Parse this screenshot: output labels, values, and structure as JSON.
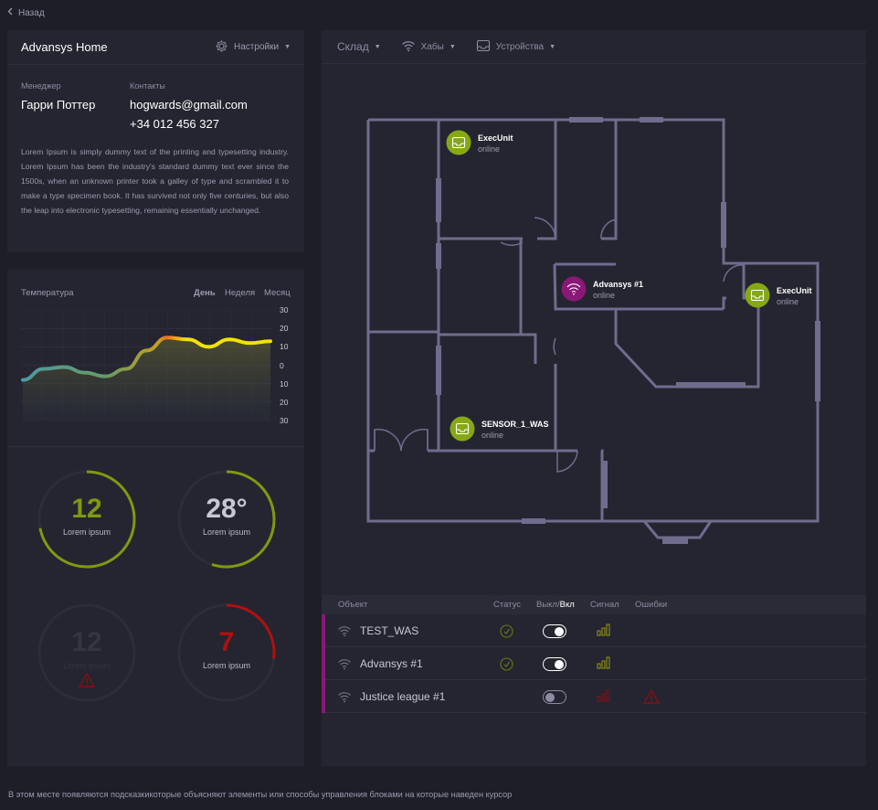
{
  "nav": {
    "back_label": "Назад"
  },
  "home": {
    "title": "Advansys Home",
    "settings_label": "Настройки",
    "manager_label": "Менеджер",
    "manager_name": "Гарри Поттер",
    "contacts_label": "Контакты",
    "email": "hogwards@gmail.com",
    "phone": "+34 012 456 327",
    "description": "Lorem Ipsum is simply dummy text of the printing and typesetting industry. Lorem Ipsum has been the industry's standard dummy text ever since the 1500s, when an unknown printer took a galley of type and scrambled it to make a type specimen book. It has survived not only five centuries, but also the leap into electronic typesetting, remaining essentially unchanged."
  },
  "temperature": {
    "label": "Температура",
    "periods": [
      "День",
      "Неделя",
      "Месяц"
    ],
    "selected_period": "День",
    "chart_data": {
      "type": "area",
      "y_ticks": [
        "30",
        "20",
        "10",
        "0",
        "10",
        "20",
        "30"
      ],
      "x": [
        0,
        1,
        2,
        3,
        4,
        5,
        6,
        7,
        8,
        9,
        10,
        11,
        12
      ],
      "values": [
        -8,
        -2,
        -1,
        -4,
        -6,
        -2,
        8,
        15,
        14,
        10,
        14,
        12,
        13
      ],
      "ylim": [
        -30,
        30
      ],
      "colors": {
        "start": "#4a9aa0",
        "mid": "#86a830",
        "end": "#f2e200",
        "peak": "#f07020"
      }
    }
  },
  "gauges": [
    {
      "value": "12",
      "caption": "Lorem ipsum",
      "color": "#7e9a10",
      "fraction": 0.72,
      "state": "normal"
    },
    {
      "value": "28°",
      "caption": "Lorem ipsum",
      "color": "#7e9a10",
      "fraction": 0.55,
      "state": "neutral"
    },
    {
      "value": "12",
      "caption": "Lorem ipsum",
      "color": "#3a3b48",
      "fraction": 0,
      "state": "error"
    },
    {
      "value": "7",
      "caption": "Lorem ipsum",
      "color": "#b01010",
      "fraction": 0.27,
      "state": "alert"
    }
  ],
  "topnav": {
    "warehouse_label": "Склад",
    "hubs_label": "Хабы",
    "devices_label": "Устройства"
  },
  "floorplan": {
    "devices": [
      {
        "name": "ExecUnit",
        "status": "online",
        "type": "device",
        "color": "#86a815"
      },
      {
        "name": "Advansys #1",
        "status": "online",
        "type": "hub",
        "color": "#8a1877"
      },
      {
        "name": "ExecUnit",
        "status": "online",
        "type": "device",
        "color": "#86a815"
      },
      {
        "name": "SENSOR_1_WAS",
        "status": "online",
        "type": "device",
        "color": "#86a815"
      }
    ]
  },
  "table": {
    "headers": {
      "object": "Объект",
      "status": "Статус",
      "switch_off": "Выкл/",
      "switch_on": "Вкл",
      "signal": "Сигнал",
      "errors": "Ошибки"
    },
    "rows": [
      {
        "name": "TEST_WAS",
        "status": "ok",
        "enabled": true,
        "signal_color": "#9a9a10",
        "error": false
      },
      {
        "name": "Advansys #1",
        "status": "ok",
        "enabled": true,
        "signal_color": "#9a9a10",
        "error": false
      },
      {
        "name": "Justice league #1",
        "status": "none",
        "enabled": false,
        "signal_color": "#8a1010",
        "error": true
      }
    ]
  },
  "hint": "В этом месте появляются подсказкикоторые объясняют элементы или способы управления блоками на которые наведен курсор"
}
